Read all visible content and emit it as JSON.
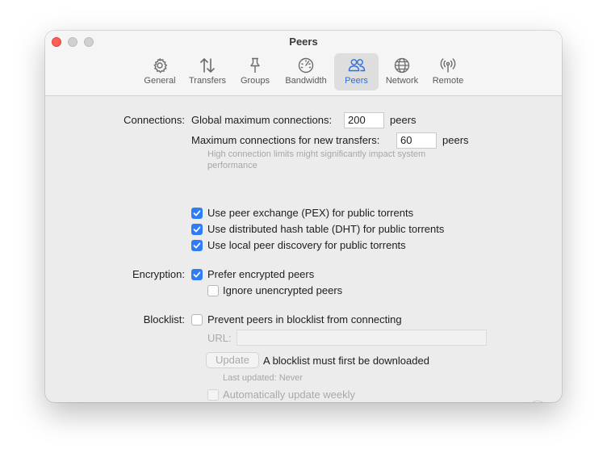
{
  "window": {
    "title": "Peers"
  },
  "tabs": [
    {
      "label": "General",
      "icon": "gear-icon"
    },
    {
      "label": "Transfers",
      "icon": "arrows-up-down-icon"
    },
    {
      "label": "Groups",
      "icon": "pushpin-icon"
    },
    {
      "label": "Bandwidth",
      "icon": "speedometer-icon"
    },
    {
      "label": "Peers",
      "icon": "people-icon",
      "active": true
    },
    {
      "label": "Network",
      "icon": "globe-icon"
    },
    {
      "label": "Remote",
      "icon": "antenna-icon"
    }
  ],
  "connections": {
    "label": "Connections:",
    "global_label": "Global maximum connections:",
    "global_value": "200",
    "global_unit": "peers",
    "new_label": "Maximum connections for new transfers:",
    "new_value": "60",
    "new_unit": "peers",
    "warning_line1": "High connection limits might significantly impact system",
    "warning_line2": "performance",
    "pex": {
      "label": "Use peer exchange (PEX) for public torrents",
      "checked": true
    },
    "dht": {
      "label": "Use distributed hash table (DHT) for public torrents",
      "checked": true
    },
    "lpd": {
      "label": "Use local peer discovery for public torrents",
      "checked": true
    }
  },
  "encryption": {
    "label": "Encryption:",
    "prefer": {
      "label": "Prefer encrypted peers",
      "checked": true
    },
    "ignore": {
      "label": "Ignore unencrypted peers",
      "checked": false
    }
  },
  "blocklist": {
    "label": "Blocklist:",
    "prevent": {
      "label": "Prevent peers in blocklist from connecting",
      "checked": false
    },
    "url_label": "URL:",
    "url_value": "",
    "update_button": "Update",
    "status": "A blocklist must first be downloaded",
    "last_updated": "Last updated: Never",
    "auto_update": {
      "label": "Automatically update weekly",
      "checked": false
    }
  },
  "help_button": "?",
  "colors": {
    "accent": "#2f7cf6",
    "active_tab_text": "#2b6fe0",
    "close": "#fe5f57"
  }
}
